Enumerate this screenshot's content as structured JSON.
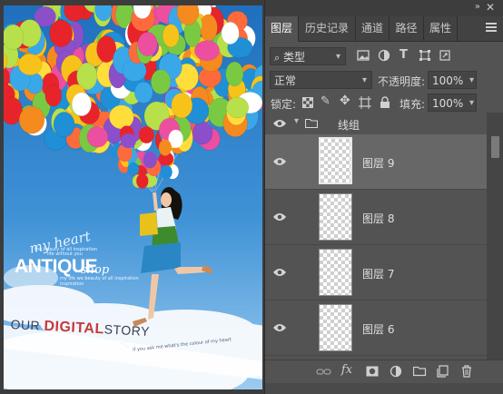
{
  "panel": {
    "tabs": [
      {
        "label": "图层",
        "active": true
      },
      {
        "label": "历史记录",
        "active": false
      },
      {
        "label": "通道",
        "active": false
      },
      {
        "label": "路径",
        "active": false
      },
      {
        "label": "属性",
        "active": false
      }
    ],
    "filter": {
      "kind": "类型",
      "search_icon": "search-icon"
    },
    "blend_mode": "正常",
    "opacity_label": "不透明度:",
    "opacity_value": "100%",
    "lock_label": "锁定:",
    "fill_label": "填充:",
    "fill_value": "100%",
    "group": {
      "name": "线组",
      "expanded": true,
      "visible": true
    },
    "layers": [
      {
        "name": "图层 9",
        "selected": true,
        "visible": true
      },
      {
        "name": "图层 8",
        "selected": false,
        "visible": true
      },
      {
        "name": "图层 7",
        "selected": false,
        "visible": true
      },
      {
        "name": "图层 6",
        "selected": false,
        "visible": true
      }
    ],
    "bottom_icons": [
      "link-icon",
      "fx-icon",
      "mask-icon",
      "adjustment-icon",
      "folder-icon",
      "new-layer-icon",
      "trash-icon"
    ],
    "fx_label": "fx"
  },
  "poster": {
    "script_text": "my heart",
    "title": "ANTIQUE",
    "title_script": "shop",
    "tagline_part1": "OUR ",
    "tagline_highlight": "DIGITAL",
    "tagline_part2": "STORY",
    "tiny_1": "the beauty of all inspiration",
    "tiny_2": "life without you",
    "tiny_3": "my life we beauty of all inspiration",
    "tiny_4": "inspiration",
    "tiny_5": "if you ask me what's the colour of my heart"
  },
  "colors": {
    "panel_bg": "#535353",
    "selected_row": "#676767",
    "sky_top": "#1f6fbd",
    "sky_bottom": "#9ccbf0",
    "highlight_red": "#c43a3a"
  }
}
